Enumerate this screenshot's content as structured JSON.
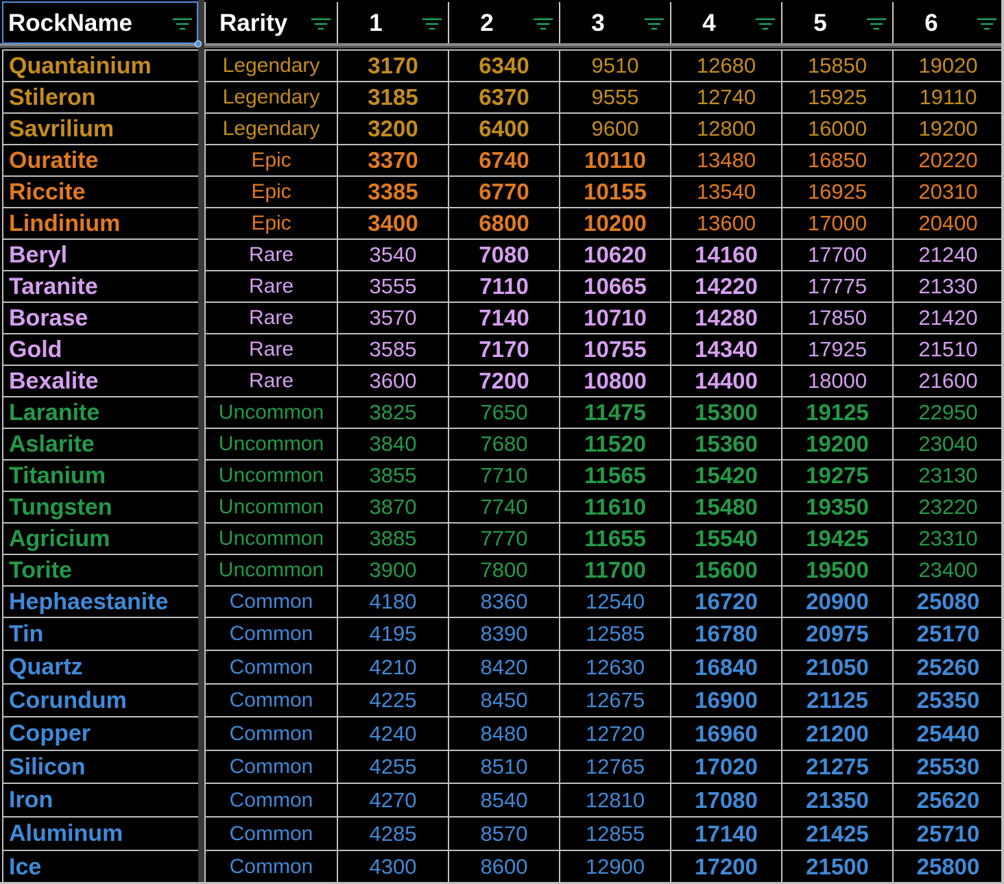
{
  "colors": {
    "Legendary": "#c48c1b",
    "Epic": "#e07a1f",
    "Rare": "#d69ef0",
    "Uncommon": "#239a47",
    "Common": "#3f8ad8",
    "filter_icon": "#1fa463",
    "selection": "#4a90e2"
  },
  "header": [
    "RockName",
    "Rarity",
    "1",
    "2",
    "3",
    "4",
    "5",
    "6"
  ],
  "rows": [
    {
      "name": "Quantainium",
      "rarity": "Legendary",
      "values": [
        "3170",
        "6340",
        "9510",
        "12680",
        "15850",
        "19020"
      ],
      "bold": [
        true,
        true,
        false,
        false,
        false,
        false
      ]
    },
    {
      "name": "Stileron",
      "rarity": "Legendary",
      "values": [
        "3185",
        "6370",
        "9555",
        "12740",
        "15925",
        "19110"
      ],
      "bold": [
        true,
        true,
        false,
        false,
        false,
        false
      ]
    },
    {
      "name": "Savrilium",
      "rarity": "Legendary",
      "values": [
        "3200",
        "6400",
        "9600",
        "12800",
        "16000",
        "19200"
      ],
      "bold": [
        true,
        true,
        false,
        false,
        false,
        false
      ]
    },
    {
      "name": "Ouratite",
      "rarity": "Epic",
      "values": [
        "3370",
        "6740",
        "10110",
        "13480",
        "16850",
        "20220"
      ],
      "bold": [
        true,
        true,
        true,
        false,
        false,
        false
      ]
    },
    {
      "name": "Riccite",
      "rarity": "Epic",
      "values": [
        "3385",
        "6770",
        "10155",
        "13540",
        "16925",
        "20310"
      ],
      "bold": [
        true,
        true,
        true,
        false,
        false,
        false
      ]
    },
    {
      "name": "Lindinium",
      "rarity": "Epic",
      "values": [
        "3400",
        "6800",
        "10200",
        "13600",
        "17000",
        "20400"
      ],
      "bold": [
        true,
        true,
        true,
        false,
        false,
        false
      ]
    },
    {
      "name": "Beryl",
      "rarity": "Rare",
      "values": [
        "3540",
        "7080",
        "10620",
        "14160",
        "17700",
        "21240"
      ],
      "bold": [
        false,
        true,
        true,
        true,
        false,
        false
      ]
    },
    {
      "name": "Taranite",
      "rarity": "Rare",
      "values": [
        "3555",
        "7110",
        "10665",
        "14220",
        "17775",
        "21330"
      ],
      "bold": [
        false,
        true,
        true,
        true,
        false,
        false
      ]
    },
    {
      "name": "Borase",
      "rarity": "Rare",
      "values": [
        "3570",
        "7140",
        "10710",
        "14280",
        "17850",
        "21420"
      ],
      "bold": [
        false,
        true,
        true,
        true,
        false,
        false
      ]
    },
    {
      "name": "Gold",
      "rarity": "Rare",
      "values": [
        "3585",
        "7170",
        "10755",
        "14340",
        "17925",
        "21510"
      ],
      "bold": [
        false,
        true,
        true,
        true,
        false,
        false
      ]
    },
    {
      "name": "Bexalite",
      "rarity": "Rare",
      "values": [
        "3600",
        "7200",
        "10800",
        "14400",
        "18000",
        "21600"
      ],
      "bold": [
        false,
        true,
        true,
        true,
        false,
        false
      ]
    },
    {
      "name": "Laranite",
      "rarity": "Uncommon",
      "values": [
        "3825",
        "7650",
        "11475",
        "15300",
        "19125",
        "22950"
      ],
      "bold": [
        false,
        false,
        true,
        true,
        true,
        false
      ]
    },
    {
      "name": "Aslarite",
      "rarity": "Uncommon",
      "values": [
        "3840",
        "7680",
        "11520",
        "15360",
        "19200",
        "23040"
      ],
      "bold": [
        false,
        false,
        true,
        true,
        true,
        false
      ]
    },
    {
      "name": "Titanium",
      "rarity": "Uncommon",
      "values": [
        "3855",
        "7710",
        "11565",
        "15420",
        "19275",
        "23130"
      ],
      "bold": [
        false,
        false,
        true,
        true,
        true,
        false
      ]
    },
    {
      "name": "Tungsten",
      "rarity": "Uncommon",
      "values": [
        "3870",
        "7740",
        "11610",
        "15480",
        "19350",
        "23220"
      ],
      "bold": [
        false,
        false,
        true,
        true,
        true,
        false
      ]
    },
    {
      "name": "Agricium",
      "rarity": "Uncommon",
      "values": [
        "3885",
        "7770",
        "11655",
        "15540",
        "19425",
        "23310"
      ],
      "bold": [
        false,
        false,
        true,
        true,
        true,
        false
      ]
    },
    {
      "name": "Torite",
      "rarity": "Uncommon",
      "values": [
        "3900",
        "7800",
        "11700",
        "15600",
        "19500",
        "23400"
      ],
      "bold": [
        false,
        false,
        true,
        true,
        true,
        false
      ]
    },
    {
      "name": "Hephaestanite",
      "rarity": "Common",
      "values": [
        "4180",
        "8360",
        "12540",
        "16720",
        "20900",
        "25080"
      ],
      "bold": [
        false,
        false,
        false,
        true,
        true,
        true
      ]
    },
    {
      "name": "Tin",
      "rarity": "Common",
      "values": [
        "4195",
        "8390",
        "12585",
        "16780",
        "20975",
        "25170"
      ],
      "bold": [
        false,
        false,
        false,
        true,
        true,
        true
      ]
    },
    {
      "name": "Quartz",
      "rarity": "Common",
      "values": [
        "4210",
        "8420",
        "12630",
        "16840",
        "21050",
        "25260"
      ],
      "bold": [
        false,
        false,
        false,
        true,
        true,
        true
      ]
    },
    {
      "name": "Corundum",
      "rarity": "Common",
      "values": [
        "4225",
        "8450",
        "12675",
        "16900",
        "21125",
        "25350"
      ],
      "bold": [
        false,
        false,
        false,
        true,
        true,
        true
      ]
    },
    {
      "name": "Copper",
      "rarity": "Common",
      "values": [
        "4240",
        "8480",
        "12720",
        "16960",
        "21200",
        "25440"
      ],
      "bold": [
        false,
        false,
        false,
        true,
        true,
        true
      ]
    },
    {
      "name": "Silicon",
      "rarity": "Common",
      "values": [
        "4255",
        "8510",
        "12765",
        "17020",
        "21275",
        "25530"
      ],
      "bold": [
        false,
        false,
        false,
        true,
        true,
        true
      ]
    },
    {
      "name": "Iron",
      "rarity": "Common",
      "values": [
        "4270",
        "8540",
        "12810",
        "17080",
        "21350",
        "25620"
      ],
      "bold": [
        false,
        false,
        false,
        true,
        true,
        true
      ]
    },
    {
      "name": "Aluminum",
      "rarity": "Common",
      "values": [
        "4285",
        "8570",
        "12855",
        "17140",
        "21425",
        "25710"
      ],
      "bold": [
        false,
        false,
        false,
        true,
        true,
        true
      ]
    },
    {
      "name": "Ice",
      "rarity": "Common",
      "values": [
        "4300",
        "8600",
        "12900",
        "17200",
        "21500",
        "25800"
      ],
      "bold": [
        false,
        false,
        false,
        true,
        true,
        true
      ]
    }
  ]
}
